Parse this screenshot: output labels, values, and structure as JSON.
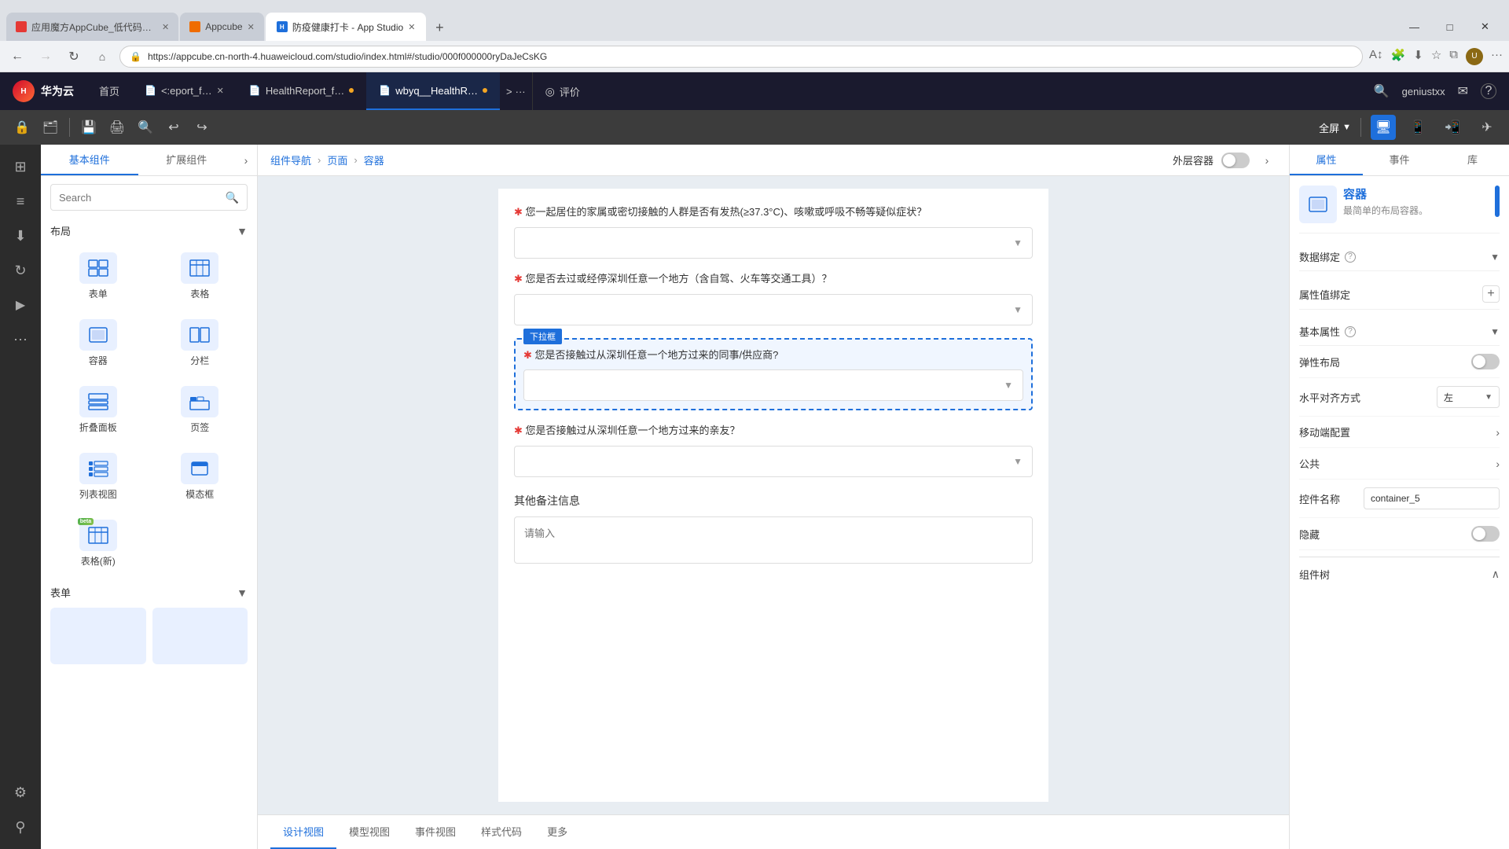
{
  "browser": {
    "tabs": [
      {
        "label": "应用魔方AppCube_低代码开发平…",
        "active": false,
        "favicon": "red"
      },
      {
        "label": "Appcube",
        "active": false,
        "favicon": "orange"
      },
      {
        "label": "防疫健康打卡 - App Studio",
        "active": true,
        "favicon": "blue"
      }
    ],
    "url": "https://appcube.cn-north-4.huaweicloud.com/studio/index.html#/studio/000f000000ryDaJeCsKG",
    "new_tab_label": "+",
    "win_min": "—",
    "win_max": "□",
    "win_close": "✕"
  },
  "app_header": {
    "logo_text": "华为云",
    "tabs": [
      {
        "label": "首页",
        "active": false,
        "closeable": false
      },
      {
        "label": "＜:eport_f…",
        "active": false,
        "closeable": true,
        "dot": false,
        "file": true
      },
      {
        "label": "HealthReport_f…",
        "active": false,
        "closeable": false,
        "dot": true,
        "file": true
      },
      {
        "label": "wbyq__HealthR…",
        "active": true,
        "closeable": false,
        "dot": true,
        "file": true
      }
    ],
    "more": "···",
    "evaluation": "评价",
    "user": "geniustxx",
    "mail_icon": "✉",
    "help_icon": "?"
  },
  "toolbar": {
    "buttons": [
      "🔒",
      "🗂",
      "|",
      "💾",
      "🖨",
      "🔍",
      "↩",
      "↪"
    ],
    "fullscreen": "全屏",
    "devices": [
      "desktop",
      "tablet",
      "phone",
      "paper"
    ]
  },
  "left_sidebar": {
    "icons": [
      "⊞",
      "≡",
      "⬇",
      "↻",
      "▶",
      "⋯",
      "⚙",
      "⚲"
    ]
  },
  "comp_panel": {
    "tabs": [
      "基本组件",
      "扩展组件"
    ],
    "active_tab": "基本组件",
    "search_placeholder": "Search",
    "sections": [
      {
        "title": "布局",
        "items": [
          {
            "label": "表单",
            "icon": "form"
          },
          {
            "label": "表格",
            "icon": "table"
          },
          {
            "label": "容器",
            "icon": "container"
          },
          {
            "label": "分栏",
            "icon": "columns"
          },
          {
            "label": "折叠面板",
            "icon": "collapse"
          },
          {
            "label": "页签",
            "icon": "tabs"
          },
          {
            "label": "列表视图",
            "icon": "list"
          },
          {
            "label": "模态框",
            "icon": "modal"
          },
          {
            "label": "表格(新)",
            "icon": "table-new",
            "beta": true
          }
        ]
      },
      {
        "title": "表单",
        "items": []
      }
    ]
  },
  "breadcrumb": {
    "items": [
      "组件导航",
      "页面",
      "容器"
    ],
    "toggle_label": "外层容器"
  },
  "canvas": {
    "questions": [
      {
        "required": true,
        "text": "您一起居住的家属或密切接触的人群是否有发热(≥37.3°C)、咳嗽或呼吸不畅等疑似症状？",
        "type": "select",
        "highlighted": false
      },
      {
        "required": true,
        "text": "您是否去过或经停深圳任意一个地方（含自驾、火车等交通工具）？",
        "type": "select",
        "highlighted": false
      },
      {
        "required": true,
        "text": "您是否接触过从深圳任意一个地方过来的同事/供应商?",
        "type": "select",
        "highlighted": true,
        "dropdown_label": "下拉框"
      },
      {
        "required": true,
        "text": "您是否接触过从深圳任意一个地方过来的亲友？",
        "type": "select",
        "highlighted": false
      }
    ],
    "other_section": {
      "title": "其他备注信息",
      "placeholder": "请输入"
    }
  },
  "bottom_tabs": {
    "tabs": [
      "设计视图",
      "模型视图",
      "事件视图",
      "样式代码",
      "更多"
    ],
    "active": "设计视图"
  },
  "right_panel": {
    "tabs": [
      "属性",
      "事件",
      "库"
    ],
    "active_tab": "属性",
    "component": {
      "name": "容器",
      "desc": "最简单的布局容器。"
    },
    "sections": [
      {
        "title": "数据绑定",
        "help": true,
        "collapsible": true,
        "controls": []
      },
      {
        "title": "属性值绑定",
        "help": false,
        "collapsible": false,
        "controls": [],
        "add": true
      },
      {
        "title": "基本属性",
        "help": true,
        "collapsible": true,
        "controls": [
          {
            "label": "弹性布局",
            "type": "toggle",
            "value": false
          },
          {
            "label": "水平对齐方式",
            "type": "select",
            "value": "左"
          },
          {
            "label": "移动端配置",
            "type": "expand"
          },
          {
            "label": "公共",
            "type": "expand"
          },
          {
            "label": "控件名称",
            "type": "input",
            "value": "container_5"
          },
          {
            "label": "隐藏",
            "type": "toggle",
            "value": false
          }
        ]
      },
      {
        "title": "组件树",
        "collapsible": true
      }
    ]
  }
}
